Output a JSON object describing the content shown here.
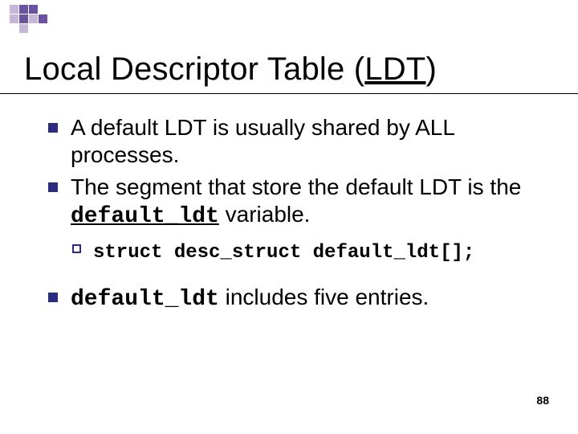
{
  "deco": {
    "cells": [
      "#c6b6d8",
      "#6a53a0",
      "#6a53a0",
      "transparent",
      "#c6b6d8",
      "#6a53a0",
      "#c6b6d8",
      "#6a53a0",
      "transparent",
      "#c6b6d8",
      "transparent",
      "transparent"
    ]
  },
  "title": {
    "pre": "Local Descriptor Table (",
    "under": "LDT",
    "post": ")"
  },
  "bullets": [
    {
      "runs": [
        {
          "t": "A default LDT is usually shared by ALL processes.",
          "cls": ""
        }
      ]
    },
    {
      "runs": [
        {
          "t": "The segment that store the default LDT is the ",
          "cls": ""
        },
        {
          "t": "default_ldt",
          "cls": "mono-u"
        },
        {
          "t": " variable.",
          "cls": ""
        }
      ],
      "sub": {
        "runs": [
          {
            "t": "struct desc_struct default_ldt[];",
            "cls": "mono"
          }
        ]
      }
    },
    {
      "runs": [
        {
          "t": "default_ldt",
          "cls": "mono"
        },
        {
          "t": " includes five entries.",
          "cls": ""
        }
      ]
    }
  ],
  "page": "88"
}
